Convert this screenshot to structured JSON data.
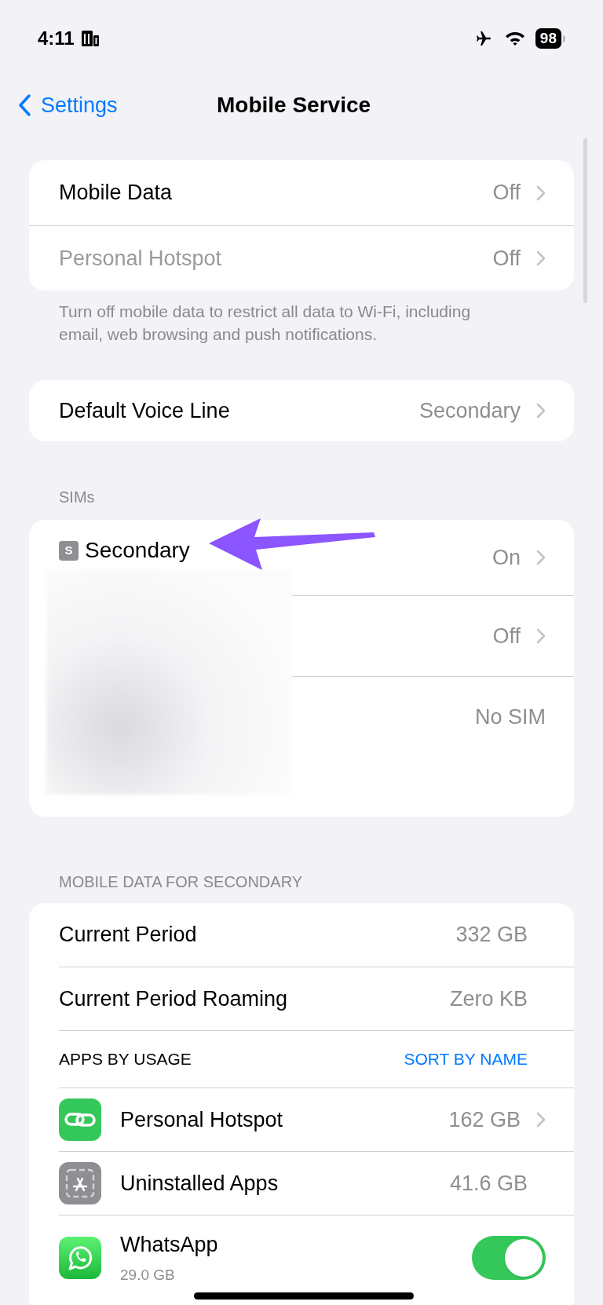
{
  "status_bar": {
    "time": "4:11",
    "battery": "98"
  },
  "nav": {
    "back": "Settings",
    "title": "Mobile Service"
  },
  "data_group": {
    "rows": [
      {
        "label": "Mobile Data",
        "value": "Off",
        "disabled": false
      },
      {
        "label": "Personal Hotspot",
        "value": "Off",
        "disabled": true
      }
    ],
    "footer": "Turn off mobile data to restrict all data to Wi-Fi, including email, web browsing and push notifications."
  },
  "voice_group": {
    "label": "Default Voice Line",
    "value": "Secondary"
  },
  "sims": {
    "header": "SIMs",
    "badge": "S",
    "label": "Secondary",
    "rows": [
      {
        "value": "On",
        "chevron": true
      },
      {
        "value": "Off",
        "chevron": true
      },
      {
        "value": "No SIM",
        "chevron": false
      }
    ]
  },
  "usage": {
    "header": "MOBILE DATA FOR SECONDARY",
    "rows": [
      {
        "label": "Current Period",
        "value": "332 GB"
      },
      {
        "label": "Current Period Roaming",
        "value": "Zero KB"
      }
    ],
    "apps_header": "APPS BY USAGE",
    "sort": "SORT BY NAME",
    "apps": [
      {
        "kind": "hotspot",
        "name": "Personal Hotspot",
        "value": "162 GB",
        "chevron": true
      },
      {
        "kind": "uninstalled",
        "name": "Uninstalled Apps",
        "value": "41.6 GB",
        "chevron": false
      },
      {
        "kind": "whatsapp",
        "name": "WhatsApp",
        "size": "29.0 GB",
        "on": true
      }
    ]
  }
}
